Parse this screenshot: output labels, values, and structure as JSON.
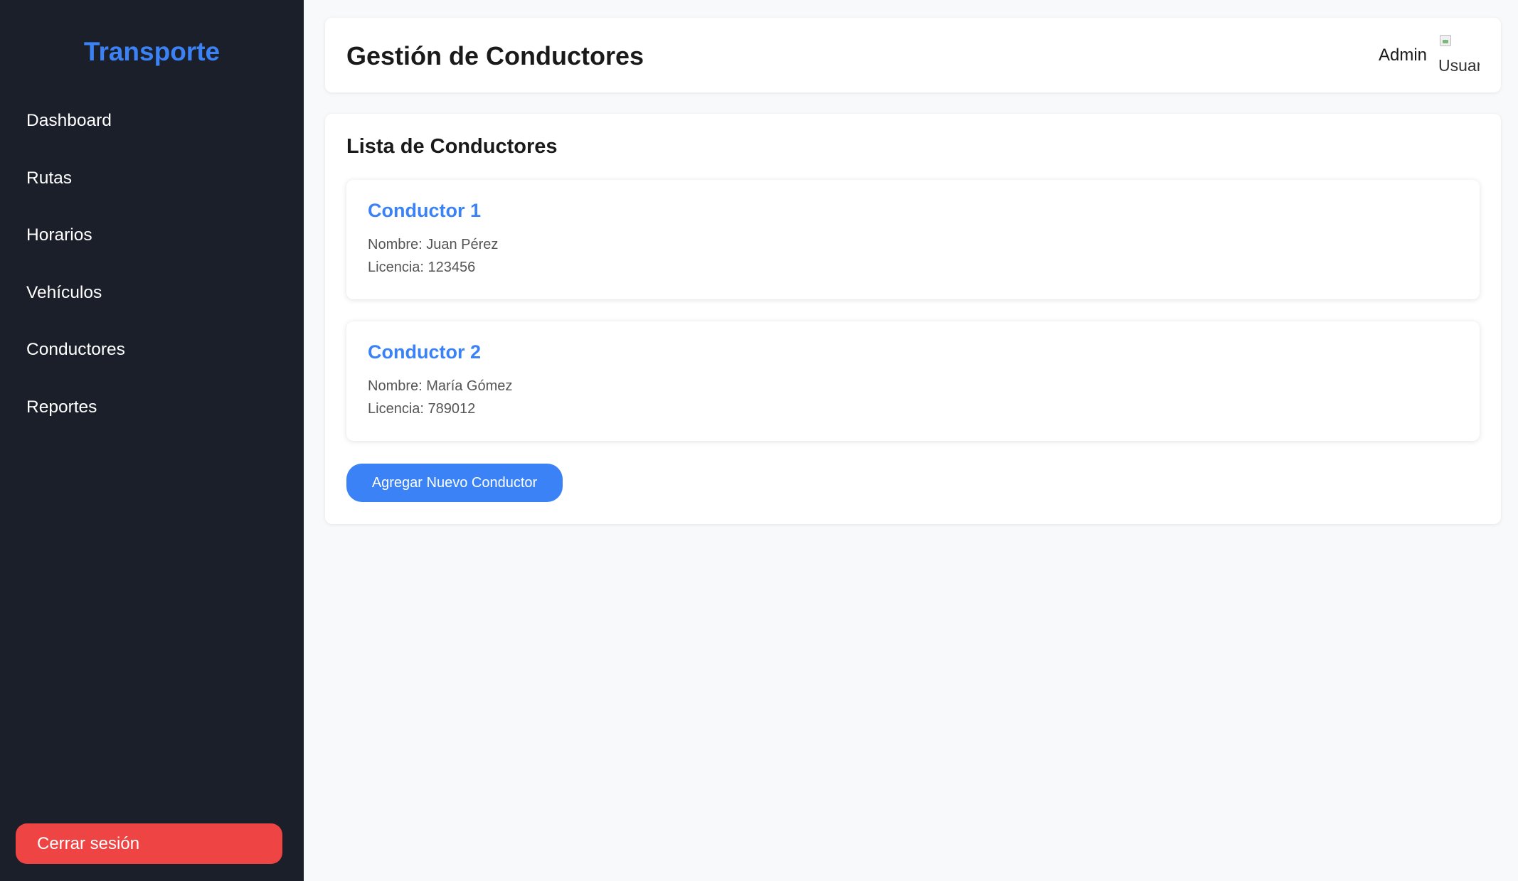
{
  "sidebar": {
    "brand": "Transporte",
    "items": [
      {
        "label": "Dashboard"
      },
      {
        "label": "Rutas"
      },
      {
        "label": "Horarios"
      },
      {
        "label": "Vehículos"
      },
      {
        "label": "Conductores"
      },
      {
        "label": "Reportes"
      }
    ],
    "logout_label": "Cerrar sesión"
  },
  "header": {
    "title": "Gestión de Conductores",
    "user_name": "Admin",
    "avatar_alt": "Usuario"
  },
  "panel": {
    "title": "Lista de Conductores",
    "cards": [
      {
        "title": "Conductor 1",
        "name": "Nombre: Juan Pérez",
        "license": "Licencia: 123456"
      },
      {
        "title": "Conductor 2",
        "name": "Nombre: María Gómez",
        "license": "Licencia: 789012"
      }
    ],
    "add_button_label": "Agregar Nuevo Conductor"
  },
  "colors": {
    "sidebar_bg": "#1b1f2a",
    "accent": "#3b82f6",
    "danger": "#ef4444",
    "page_bg": "#f8f9fb"
  }
}
